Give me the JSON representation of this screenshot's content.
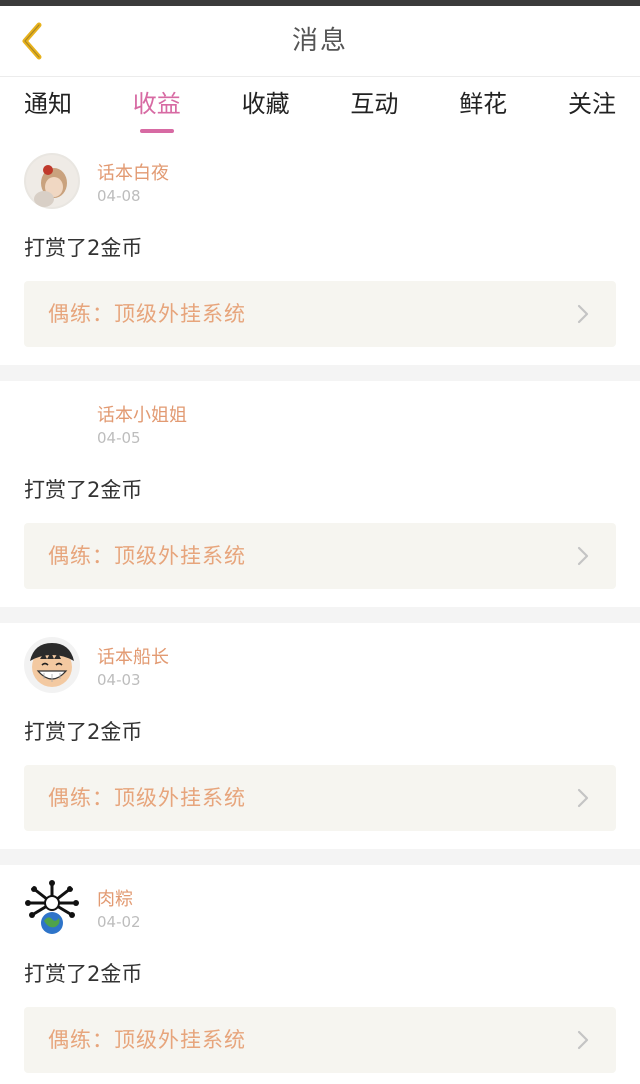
{
  "header": {
    "title": "消息",
    "back_icon": "chevron-left-icon",
    "accent_color": "#e8b21c"
  },
  "tabs": [
    {
      "label": "通知",
      "active": false
    },
    {
      "label": "收益",
      "active": true
    },
    {
      "label": "收藏",
      "active": false
    },
    {
      "label": "互动",
      "active": false
    },
    {
      "label": "鲜花",
      "active": false
    },
    {
      "label": "关注",
      "active": false
    }
  ],
  "colors": {
    "tab_active": "#d76aa3",
    "username": "#e29a72",
    "book_title": "#e7a57c",
    "card_bg": "#f6f5f0"
  },
  "messages": [
    {
      "username": "话本白夜",
      "date": "04-08",
      "action": "打赏了2金币",
      "book": "偶练：顶级外挂系统",
      "avatar": "girl-avatar"
    },
    {
      "username": "话本小姐姐",
      "date": "04-05",
      "action": "打赏了2金币",
      "book": "偶练：顶级外挂系统",
      "avatar": "blank-avatar"
    },
    {
      "username": "话本船长",
      "date": "04-03",
      "action": "打赏了2金币",
      "book": "偶练：顶级外挂系统",
      "avatar": "luffy-avatar"
    },
    {
      "username": "肉粽",
      "date": "04-02",
      "action": "打赏了2金币",
      "book": "偶练：顶级外挂系统",
      "avatar": "earth-virus-avatar"
    }
  ]
}
